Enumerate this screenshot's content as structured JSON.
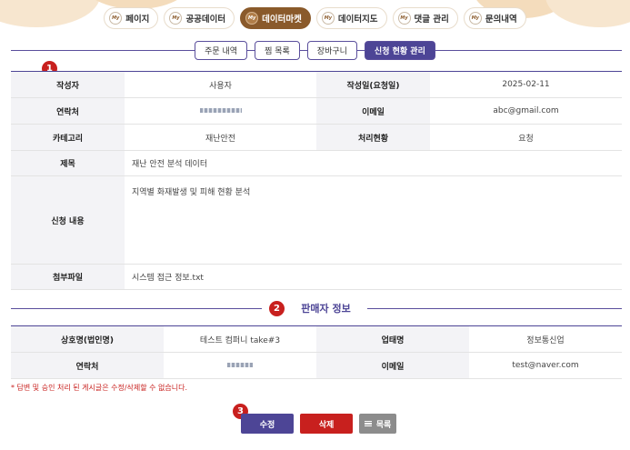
{
  "colors": {
    "accent": "#4d4596",
    "brand": "#8a5a2b",
    "danger": "#c8201e",
    "header_bg": "#f3f3f6"
  },
  "top_tabs": [
    {
      "icon_text": "My",
      "label": "페이지",
      "active": false
    },
    {
      "icon_text": "My",
      "label": "공공데이터",
      "active": false
    },
    {
      "icon_text": "My",
      "label": "데이터마켓",
      "active": true
    },
    {
      "icon_text": "My",
      "label": "데이터지도",
      "active": false
    },
    {
      "icon_text": "My",
      "label": "댓글 관리",
      "active": false
    },
    {
      "icon_text": "My",
      "label": "문의내역",
      "active": false
    }
  ],
  "sub_tabs": [
    {
      "label": "주문 내역",
      "active": false
    },
    {
      "label": "찜 목록",
      "active": false
    },
    {
      "label": "장바구니",
      "active": false
    },
    {
      "label": "신청 현황 관리",
      "active": true
    }
  ],
  "badges": {
    "one": "1",
    "two": "2",
    "three": "3"
  },
  "request": {
    "author_label": "작성자",
    "author_value": "사용자",
    "date_label": "작성일(요청일)",
    "date_value": "2025-02-11",
    "contact_label": "연락처",
    "email_label": "이메일",
    "email_value": "abc@gmail.com",
    "category_label": "카테고리",
    "category_value": "재난안전",
    "status_label": "처리현황",
    "status_value": "요청",
    "title_label": "제목",
    "title_value": "재난 안전 분석 데이터",
    "content_label": "신청 내용",
    "content_value": "지역별 화재발생 및 피해 현황 분석",
    "attach_label": "첨부파일",
    "attach_value": "시스템 접근 정보.txt"
  },
  "seller": {
    "section_title": "판매자 정보",
    "company_label": "상호명(법인명)",
    "company_value": "테스트 컴퍼니 take#3",
    "business_label": "업태명",
    "business_value": "정보통신업",
    "contact_label": "연락처",
    "email_label": "이메일",
    "email_value": "test@naver.com"
  },
  "notice": "* 답변 및 승인 처리 된 게시글은 수정/삭제할 수 없습니다.",
  "buttons": {
    "edit": "수정",
    "delete": "삭제",
    "list": "목록"
  }
}
